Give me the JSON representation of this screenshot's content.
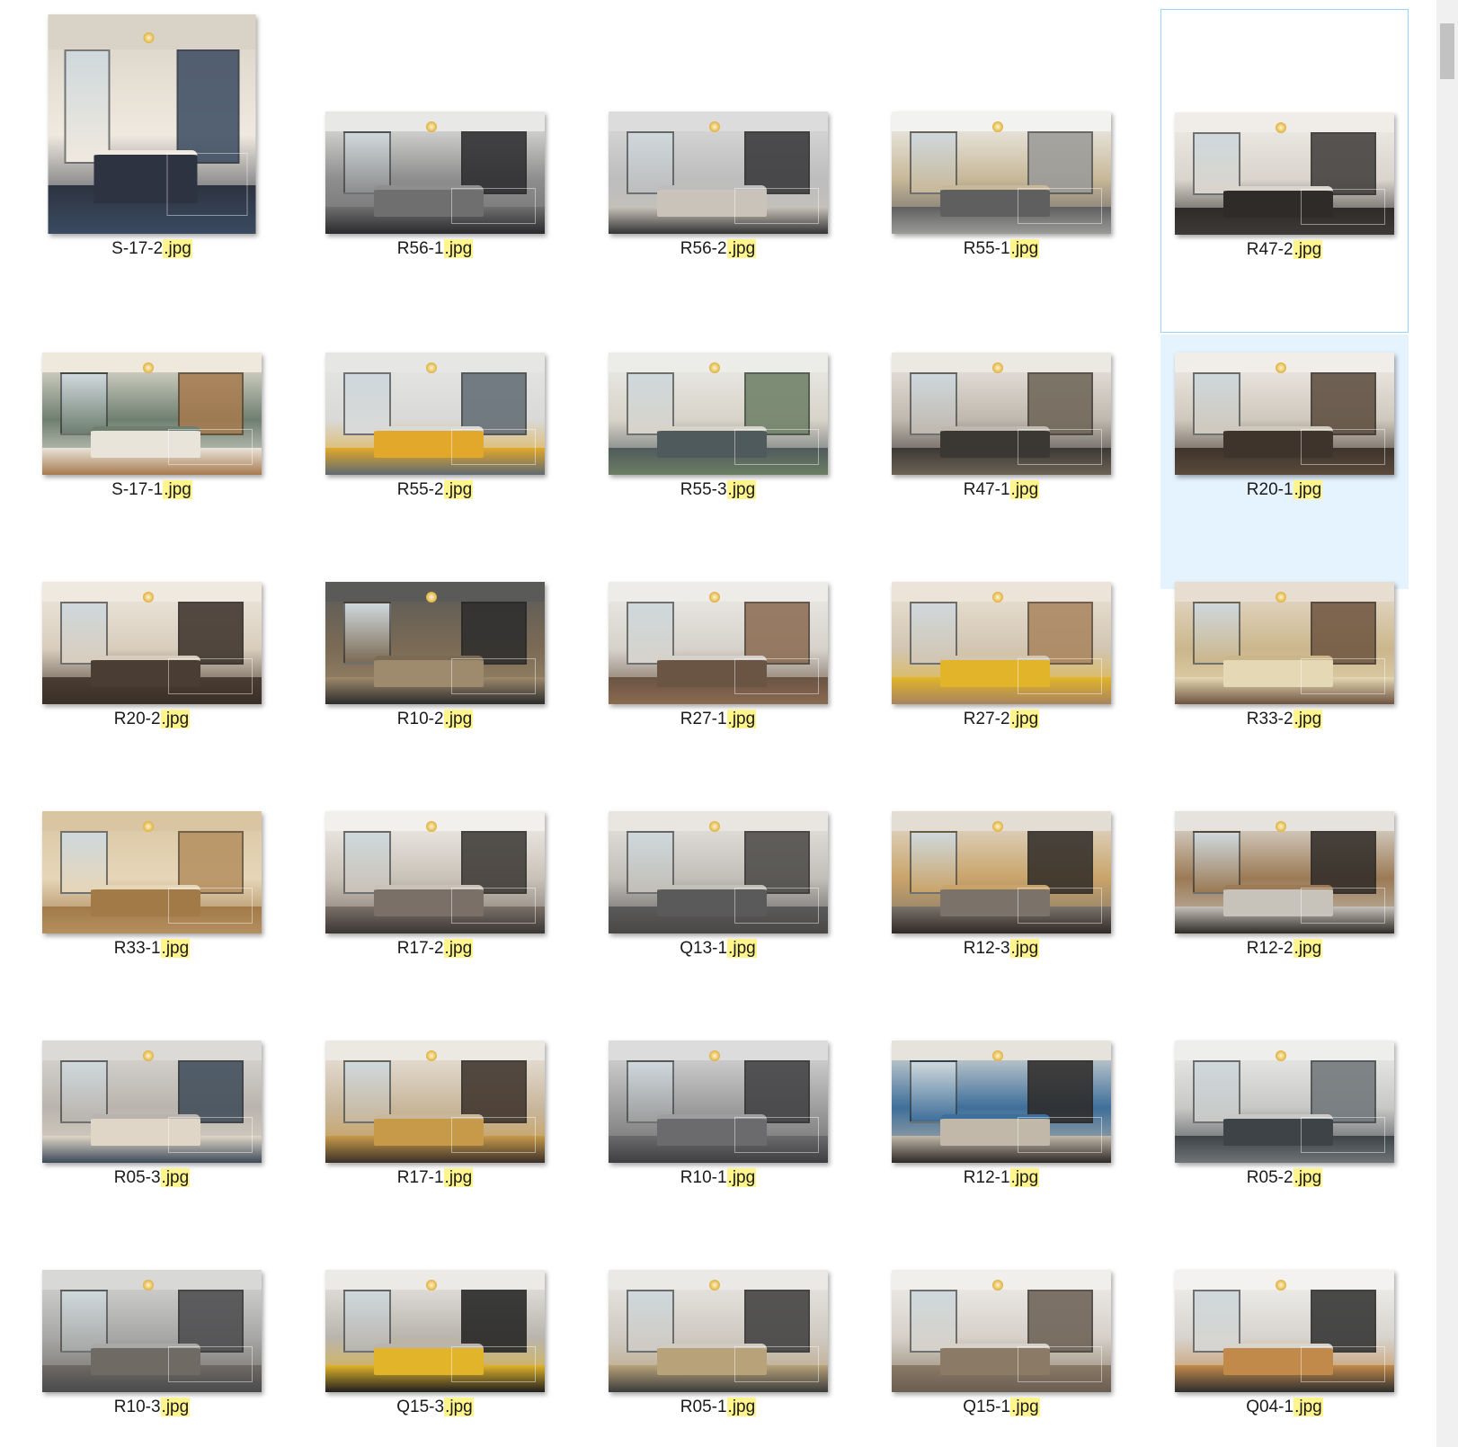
{
  "files": [
    {
      "name": "S-17-2",
      "ext": ".jpg",
      "palette": [
        "#d9d2c6",
        "#3a4a60",
        "#efe9df",
        "#2d3340"
      ],
      "portrait": true
    },
    {
      "name": "R56-1",
      "ext": ".jpg",
      "palette": [
        "#e8e8e6",
        "#2a2a2c",
        "#8e8e8e",
        "#6f6f70"
      ]
    },
    {
      "name": "R56-2",
      "ext": ".jpg",
      "palette": [
        "#dcdcdc",
        "#343436",
        "#bdbdbd",
        "#c9c3b9"
      ]
    },
    {
      "name": "R55-1",
      "ext": ".jpg",
      "palette": [
        "#f2f2f0",
        "#9a9a98",
        "#c8b89a",
        "#5f5f60"
      ]
    },
    {
      "name": "R47-2",
      "ext": ".jpg",
      "palette": [
        "#f0ede8",
        "#3d3a38",
        "#d9d4cc",
        "#2e2b29"
      ]
    },
    {
      "name": "S-17-1",
      "ext": ".jpg",
      "palette": [
        "#efe8dc",
        "#a77a4e",
        "#6e7f70",
        "#e9e4da"
      ]
    },
    {
      "name": "R55-2",
      "ext": ".jpg",
      "palette": [
        "#e6e6e4",
        "#5f6a72",
        "#d9d9d7",
        "#e2a82b"
      ]
    },
    {
      "name": "R55-3",
      "ext": ".jpg",
      "palette": [
        "#ecece8",
        "#6c7e64",
        "#d7d3c9",
        "#4f5a5c"
      ]
    },
    {
      "name": "R47-1",
      "ext": ".jpg",
      "palette": [
        "#ece8e2",
        "#6d6356",
        "#bfb8ae",
        "#3b3834"
      ]
    },
    {
      "name": "R20-1",
      "ext": ".jpg",
      "palette": [
        "#f1eee9",
        "#5a4a3c",
        "#cfc8bd",
        "#3e342c"
      ]
    },
    {
      "name": "R20-2",
      "ext": ".jpg",
      "palette": [
        "#efe9df",
        "#3a2f28",
        "#d8cdbd",
        "#4a3d33"
      ]
    },
    {
      "name": "R10-2",
      "ext": ".jpg",
      "palette": [
        "#5a5a58",
        "#2c2c2c",
        "#7b6b55",
        "#9e8a6c"
      ]
    },
    {
      "name": "R27-1",
      "ext": ".jpg",
      "palette": [
        "#eeece8",
        "#8a6a50",
        "#d6d2cb",
        "#6a5444"
      ]
    },
    {
      "name": "R27-2",
      "ext": ".jpg",
      "palette": [
        "#ece4d8",
        "#a8845e",
        "#d2c5b2",
        "#e1b42a"
      ]
    },
    {
      "name": "R33-2",
      "ext": ".jpg",
      "palette": [
        "#e7ddd0",
        "#6e5440",
        "#cbb68c",
        "#e5d8b4"
      ]
    },
    {
      "name": "R33-1",
      "ext": ".jpg",
      "palette": [
        "#d9c5a2",
        "#b48f5f",
        "#e6d6b8",
        "#a27a48"
      ]
    },
    {
      "name": "R17-2",
      "ext": ".jpg",
      "palette": [
        "#f2f0ec",
        "#3a3632",
        "#c9c2b8",
        "#7a7068"
      ]
    },
    {
      "name": "Q13-1",
      "ext": ".jpg",
      "palette": [
        "#e9e6e1",
        "#4a4846",
        "#c2beb8",
        "#5a5a5a"
      ]
    },
    {
      "name": "R12-3",
      "ext": ".jpg",
      "palette": [
        "#e3ddd4",
        "#2f2a26",
        "#c9a46a",
        "#7b736a"
      ]
    },
    {
      "name": "R12-2",
      "ext": ".jpg",
      "palette": [
        "#e6e3de",
        "#2f2b27",
        "#9b7a55",
        "#c7c2ba"
      ]
    },
    {
      "name": "R05-3",
      "ext": ".jpg",
      "palette": [
        "#dcdad6",
        "#3c4a58",
        "#b9b4ad",
        "#e0d6c8"
      ]
    },
    {
      "name": "R17-1",
      "ext": ".jpg",
      "palette": [
        "#ece8e2",
        "#3b3029",
        "#c8b79c",
        "#c79a4a"
      ]
    },
    {
      "name": "R10-1",
      "ext": ".jpg",
      "palette": [
        "#dcdcdc",
        "#3e3e40",
        "#9e9e9e",
        "#6b6b6d"
      ]
    },
    {
      "name": "R12-1",
      "ext": ".jpg",
      "palette": [
        "#e6e2dc",
        "#2d2926",
        "#3e6f9a",
        "#c2b8aa"
      ]
    },
    {
      "name": "R05-2",
      "ext": ".jpg",
      "palette": [
        "#eeeeec",
        "#6e7478",
        "#c8c8c6",
        "#3e4348"
      ]
    },
    {
      "name": "R10-3",
      "ext": ".jpg",
      "palette": [
        "#d8d8d6",
        "#4a4a4c",
        "#a8a8a6",
        "#6f6a64"
      ]
    },
    {
      "name": "Q15-3",
      "ext": ".jpg",
      "palette": [
        "#eceae6",
        "#1f1f1f",
        "#b9b5ae",
        "#e1b42a"
      ]
    },
    {
      "name": "R05-1",
      "ext": ".jpg",
      "palette": [
        "#ebe9e5",
        "#3c3c3c",
        "#cfcac2",
        "#b8a27a"
      ]
    },
    {
      "name": "Q15-1",
      "ext": ".jpg",
      "palette": [
        "#f1efec",
        "#6a5e52",
        "#d6d1c9",
        "#8a7a66"
      ]
    },
    {
      "name": "Q04-1",
      "ext": ".jpg",
      "palette": [
        "#f3f2f0",
        "#2e2e2e",
        "#d7d4cf",
        "#c28a4a"
      ]
    }
  ],
  "selected_index": 9,
  "focused_index": 4,
  "colors": {
    "selection": "#e5f3ff",
    "focus_border": "#99d1ff",
    "extension_highlight": "#fff58c"
  }
}
